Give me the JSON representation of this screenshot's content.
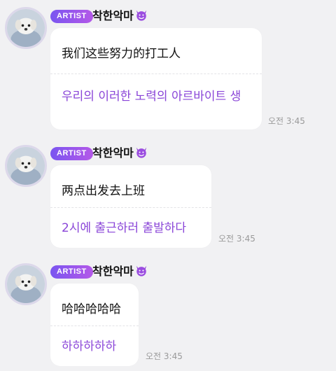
{
  "messages": [
    {
      "badge": "ARTIST",
      "sender": "착한악마",
      "original": "我们这些努力的打工人",
      "translation": "우리의 이러한 노력의 아르바이트 생",
      "time": "오전 3:45"
    },
    {
      "badge": "ARTIST",
      "sender": "착한악마",
      "original": "两点出发去上班",
      "translation": "2시에 출근하러 출발하다",
      "time": "오전 3:45"
    },
    {
      "badge": "ARTIST",
      "sender": "착한악마",
      "original": "哈哈哈哈哈",
      "translation": "하하하하하",
      "time": "오전 3:45"
    }
  ],
  "icons": {
    "devil": "smiling-devil-emoji-icon"
  },
  "colors": {
    "badge_start": "#7a55f0",
    "badge_end": "#b458e8",
    "translation": "#8a45d8"
  }
}
